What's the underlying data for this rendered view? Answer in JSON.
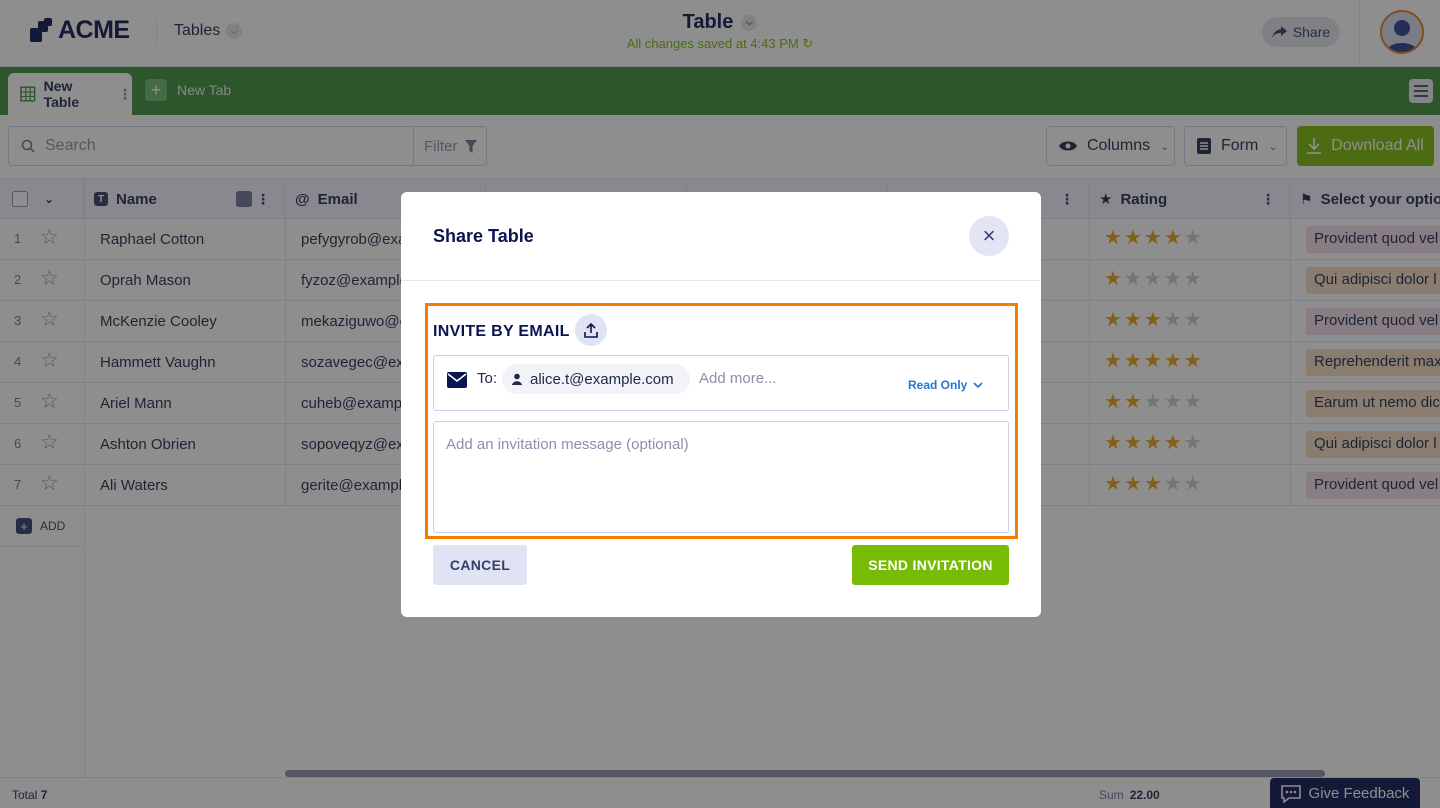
{
  "header": {
    "logo_text": "ACME",
    "tables_label": "Tables",
    "title": "Table",
    "saved_status": "All changes saved at 4:43 PM",
    "share_label": "Share"
  },
  "tabs": {
    "active_label": "New Table",
    "new_label": "New Tab"
  },
  "toolbar": {
    "search_placeholder": "Search",
    "filter_label": "Filter",
    "columns_label": "Columns",
    "form_label": "Form",
    "download_label": "Download All"
  },
  "table": {
    "columns": [
      "Name",
      "Email",
      "Rating",
      "Select your option"
    ],
    "rows": [
      {
        "num": "1",
        "name": "Raphael Cotton",
        "email": "pefygyrob@example.com",
        "rating": 4,
        "option": "Provident quod vel"
      },
      {
        "num": "2",
        "name": "Oprah Mason",
        "email": "fyzoz@example.com",
        "rating": 1,
        "option": "Qui adipisci dolor l"
      },
      {
        "num": "3",
        "name": "McKenzie Cooley",
        "email": "mekaziguwo@example.com",
        "rating": 3,
        "option": "Provident quod vel"
      },
      {
        "num": "4",
        "name": "Hammett Vaughn",
        "email": "sozavegec@example.com",
        "rating": 5,
        "option": "Reprehenderit maxim"
      },
      {
        "num": "5",
        "name": "Ariel Mann",
        "email": "cuheb@example.com",
        "rating": 2,
        "option": "Earum ut nemo dicta"
      },
      {
        "num": "6",
        "name": "Ashton Obrien",
        "email": "sopoveqyz@example.com",
        "rating": 4,
        "option": "Qui adipisci dolor l"
      },
      {
        "num": "7",
        "name": "Ali Waters",
        "email": "gerite@example.com",
        "rating": 3,
        "option": "Provident quod vel"
      }
    ],
    "add_label": "ADD"
  },
  "footer": {
    "total_label": "Total",
    "total_value": "7",
    "sum_label": "Sum",
    "sum_value": "22.00",
    "feedback_label": "Give Feedback"
  },
  "modal": {
    "title": "Share Table",
    "invite_title": "INVITE BY EMAIL",
    "to_label": "To:",
    "chip_email": "alice.t@example.com",
    "add_more_placeholder": "Add more...",
    "permission": "Read Only",
    "message_placeholder": "Add an invitation message (optional)",
    "cancel_label": "CANCEL",
    "send_label": "SEND INVITATION"
  },
  "colors": {
    "brand_navy": "#0a1551",
    "tab_green": "#3d8f3d",
    "action_green": "#78bb07",
    "highlight_orange": "#f57c00",
    "star_gold": "#e8a317",
    "tag_pink": "#f3dce8",
    "tag_orange": "#f7dcc0"
  }
}
